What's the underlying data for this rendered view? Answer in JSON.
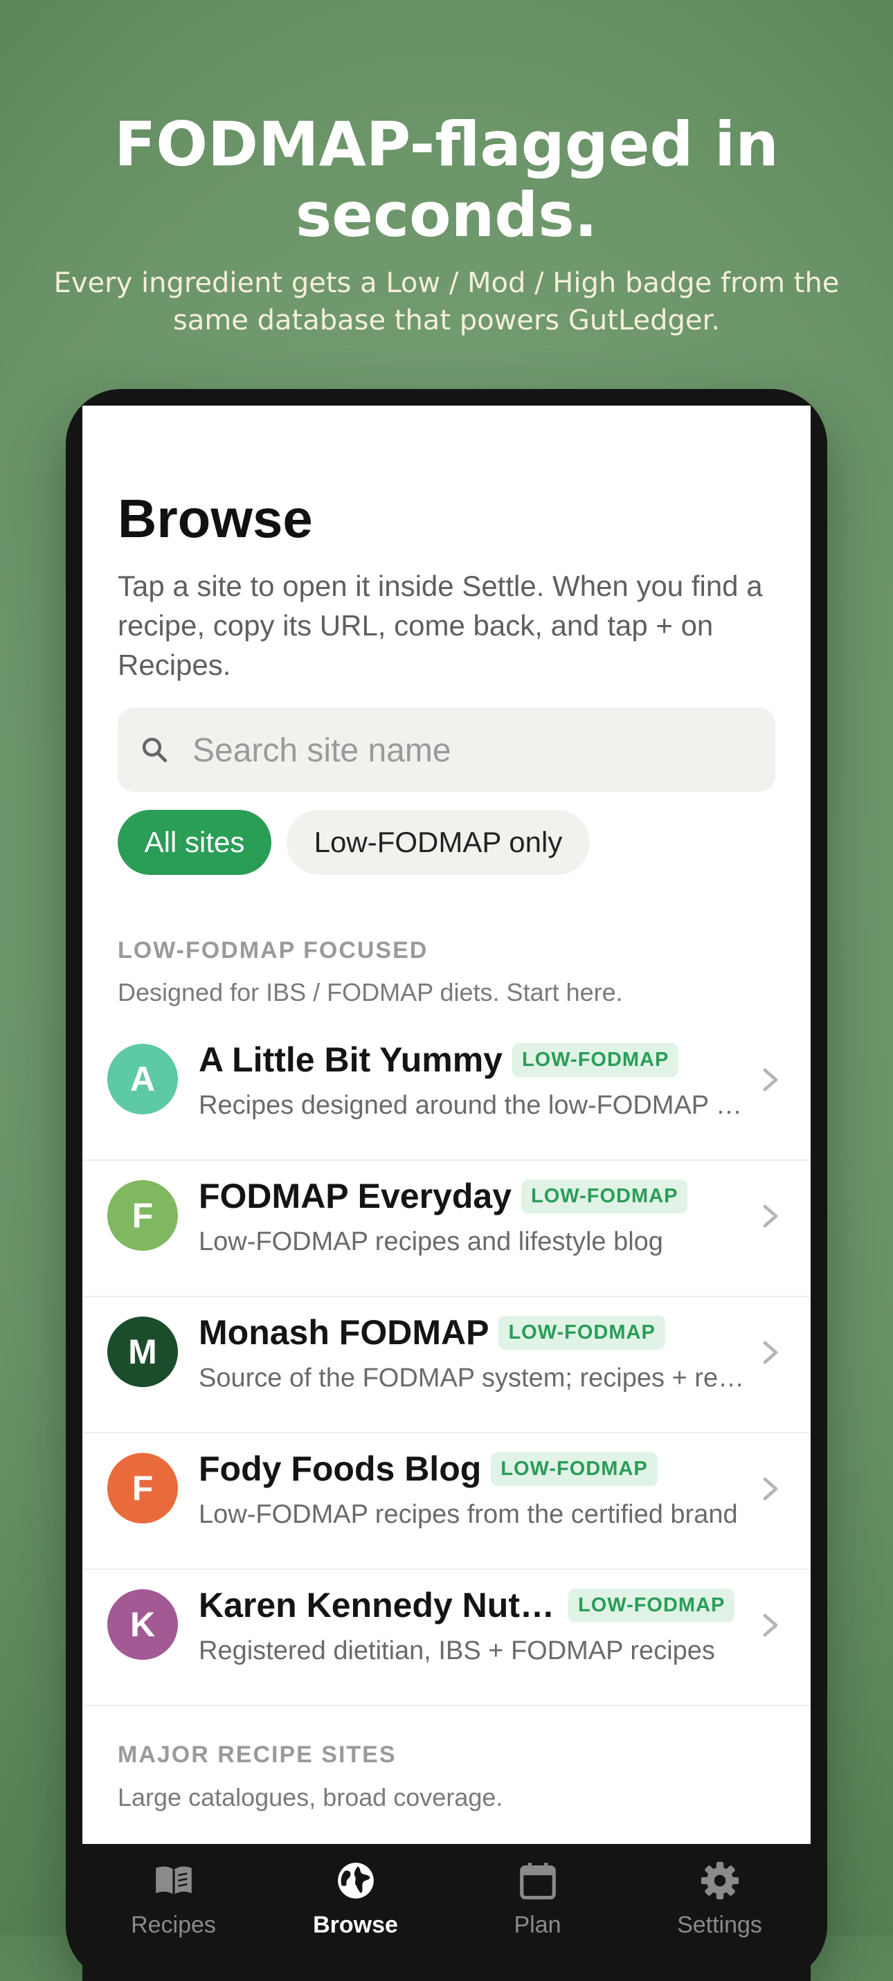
{
  "hero": {
    "title": "FODMAP-flagged in seconds.",
    "subtitle": "Every ingredient gets a Low / Mod / High badge from the same database that powers GutLedger."
  },
  "browse": {
    "title": "Browse",
    "intro": "Tap a site to open it inside Settle. When you find a recipe, copy its URL, come back, and tap + on Recipes.",
    "search": {
      "placeholder": "Search site name",
      "value": ""
    },
    "filters": {
      "all_sites": "All sites",
      "low_fodmap_only": "Low-FODMAP only",
      "selected": "All sites"
    },
    "sections": {
      "low_fodmap": {
        "label": "LOW-FODMAP FOCUSED",
        "description": "Designed for IBS / FODMAP diets. Start here."
      },
      "major": {
        "label": "MAJOR RECIPE SITES",
        "description": "Large catalogues, broad coverage."
      }
    },
    "sites": [
      {
        "initial": "A",
        "name": "A Little Bit Yummy",
        "badge": "LOW-FODMAP",
        "description": "Recipes designed around the low-FODMAP diet",
        "color": "#5ec9a6"
      },
      {
        "initial": "F",
        "name": "FODMAP Everyday",
        "badge": "LOW-FODMAP",
        "description": "Low-FODMAP recipes and lifestyle blog",
        "color": "#7fb860"
      },
      {
        "initial": "M",
        "name": "Monash FODMAP",
        "badge": "LOW-FODMAP",
        "description": "Source of the FODMAP system; recipes + research",
        "color": "#1b4d2c"
      },
      {
        "initial": "F",
        "name": "Fody Foods Blog",
        "badge": "LOW-FODMAP",
        "description": "Low-FODMAP recipes from the certified brand",
        "color": "#e96b3c"
      },
      {
        "initial": "K",
        "name": "Karen Kennedy Nutrition",
        "badge": "LOW-FODMAP",
        "description": "Registered dietitian, IBS + FODMAP recipes",
        "color": "#a35a94"
      }
    ]
  },
  "tabbar": {
    "recipes": "Recipes",
    "browse": "Browse",
    "plan": "Plan",
    "settings": "Settings",
    "active": "Browse"
  },
  "colors": {
    "accent": "#2a9d57",
    "badge_bg": "#e0f3e6",
    "background": "#6b9468"
  }
}
